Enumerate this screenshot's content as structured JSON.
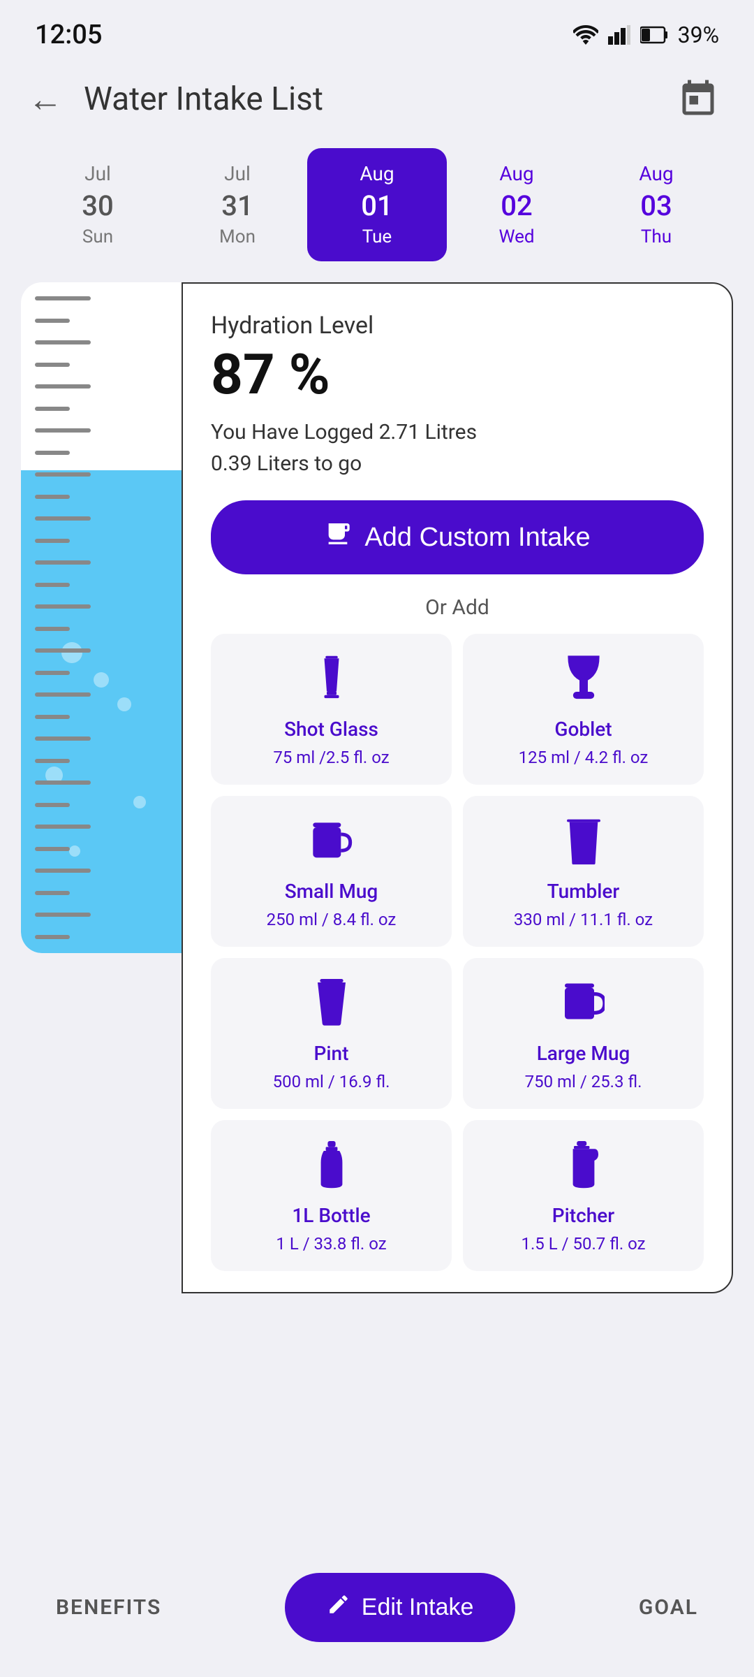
{
  "statusBar": {
    "time": "12:05",
    "battery": "39%"
  },
  "header": {
    "title": "Water Intake List"
  },
  "dates": [
    {
      "id": "jul30",
      "month": "Jul",
      "dayNum": "30",
      "dayName": "Sun",
      "state": "normal"
    },
    {
      "id": "jul31",
      "month": "Jul",
      "dayNum": "31",
      "dayName": "Mon",
      "state": "normal"
    },
    {
      "id": "aug01",
      "month": "Aug",
      "dayNum": "01",
      "dayName": "Tue",
      "state": "active"
    },
    {
      "id": "aug02",
      "month": "Aug",
      "dayNum": "02",
      "dayName": "Wed",
      "state": "future"
    },
    {
      "id": "aug03",
      "month": "Aug",
      "dayNum": "03",
      "dayName": "Thu",
      "state": "future"
    }
  ],
  "hydration": {
    "label": "Hydration Level",
    "percent": "87 %",
    "logged": "You Have Logged 2.71 Litres",
    "toGo": "0.39  Liters to go"
  },
  "addCustomBtn": {
    "label": "Add Custom Intake"
  },
  "orAdd": "Or Add",
  "drinkItems": [
    {
      "id": "shot-glass",
      "name": "Shot Glass",
      "volume": "75 ml /2.5 fl. oz",
      "iconType": "shot-glass"
    },
    {
      "id": "goblet",
      "name": "Goblet",
      "volume": "125 ml / 4.2 fl. oz",
      "iconType": "goblet"
    },
    {
      "id": "small-mug",
      "name": "Small Mug",
      "volume": "250 ml / 8.4 fl. oz",
      "iconType": "small-mug"
    },
    {
      "id": "tumbler",
      "name": "Tumbler",
      "volume": "330 ml / 11.1 fl. oz",
      "iconType": "tumbler"
    },
    {
      "id": "pint",
      "name": "Pint",
      "volume": "500 ml / 16.9 fl.",
      "iconType": "pint"
    },
    {
      "id": "large-mug",
      "name": "Large Mug",
      "volume": "750 ml / 25.3 fl.",
      "iconType": "large-mug"
    },
    {
      "id": "1l-bottle",
      "name": "1L Bottle",
      "volume": "1 L / 33.8 fl. oz",
      "iconType": "bottle"
    },
    {
      "id": "pitcher",
      "name": "Pitcher",
      "volume": "1.5 L / 50.7 fl. oz",
      "iconType": "pitcher"
    }
  ],
  "bottomNav": {
    "benefits": "BENEFITS",
    "editIntake": "Edit Intake",
    "goal": "GOAL"
  }
}
